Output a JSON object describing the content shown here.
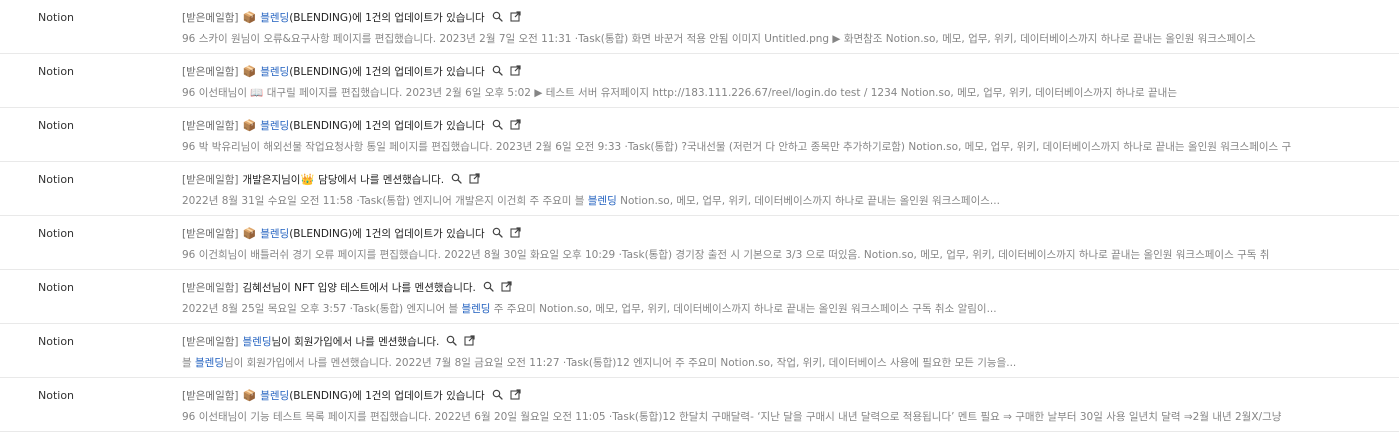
{
  "rows": [
    {
      "sender": "Notion",
      "tag": "[받은메일함]",
      "emoji": "📦",
      "subject_link": "블렌딩",
      "subject_rest": "(BLENDING)에 1건의 업데이트가 있습니다",
      "preview_prefix": "96 스카이 원님이 오류&요구사항 페이지를 편집했습니다. 2023년 2월 7일 오전 11:31 ·Task(통합) 화면 바꾼거 적용 안됨 이미지 Untitled.png ▶ 화면참조 Notion.so, 메모, 업무, 위키, 데이터베이스까지 하나로 끝내는 올인원 워크스페이스"
    },
    {
      "sender": "Notion",
      "tag": "[받은메일함]",
      "emoji": "📦",
      "subject_link": "블렌딩",
      "subject_rest": "(BLENDING)에 1건의 업데이트가 있습니다",
      "preview_prefix": "96 이선태님이 📖 대구릴 페이지를 편집했습니다. 2023년 2월 6일 오후 5:02 ▶ 테스트 서버 유저페이지 http://183.111.226.67/reel/login.do test / 1234 Notion.so, 메모, 업무, 위키, 데이터베이스까지 하나로 끝내는"
    },
    {
      "sender": "Notion",
      "tag": "[받은메일함]",
      "emoji": "📦",
      "subject_link": "블렌딩",
      "subject_rest": "(BLENDING)에 1건의 업데이트가 있습니다",
      "preview_prefix": "96 박 박유리님이 해외선물 작업요청사항 통일 페이지를 편집했습니다. 2023년 2월 6일 오전 9:33 ·Task(통합) ?국내선물 (저런거 다 안하고 종목만 추가하기로함) Notion.so, 메모, 업무, 위키, 데이터베이스까지 하나로 끝내는 올인원 워크스페이스 구"
    },
    {
      "sender": "Notion",
      "tag": "[받은메일함]",
      "emoji": "👑",
      "subject_pre": "개발은지님이 ",
      "subject_rest": " 담당에서 나를 멘션했습니다.",
      "preview_prefix": "2022년 8월 31일 수요일 오전 11:58 ·Task(통합) 엔지니어 개발은지 이건희 주 주요미 블 ",
      "preview_link": "블렌딩",
      "preview_suffix": " Notion.so, 메모, 업무, 위키, 데이터베이스까지 하나로 끝내는 올인원 워크스페이스..."
    },
    {
      "sender": "Notion",
      "tag": "[받은메일함]",
      "emoji": "📦",
      "subject_link": "블렌딩",
      "subject_rest": "(BLENDING)에 1건의 업데이트가 있습니다",
      "preview_prefix": "96 이건희님이 배틀러쉬 경기 오류 페이지를 편집했습니다. 2022년 8월 30일 화요일 오후 10:29 ·Task(통합) 경기장 출전 시 기본으로 3/3 으로 떠있음. Notion.so, 메모, 업무, 위키, 데이터베이스까지 하나로 끝내는 올인원 워크스페이스 구독 취"
    },
    {
      "sender": "Notion",
      "tag": "[받은메일함]",
      "subject_pre": "김혜선님이 NFT 입양 테스트에서 나를 멘션했습니다.",
      "preview_prefix": "2022년 8월 25일 목요일 오후 3:57 ·Task(통합) 엔지니어 블 ",
      "preview_link": "블렌딩",
      "preview_suffix": " 주 주요미 Notion.so, 메모, 업무, 위키, 데이터베이스까지 하나로 끝내는 올인원 워크스페이스 구독 취소 알림이..."
    },
    {
      "sender": "Notion",
      "tag": "[받은메일함]",
      "subject_link": "블렌딩",
      "subject_rest": "님이 회원가입에서 나를 멘션했습니다.",
      "preview_prefix": "블 ",
      "preview_link": "블렌딩",
      "preview_suffix": "님이 회원가입에서 나를 멘션했습니다. 2022년 7월 8일 금요일 오전 11:27 ·Task(통합)12 엔지니어 주 주요미 Notion.so, 작업, 위키, 데이터베이스 사용에 필요한 모든 기능을..."
    },
    {
      "sender": "Notion",
      "tag": "[받은메일함]",
      "emoji": "📦",
      "subject_link": "블렌딩",
      "subject_rest": "(BLENDING)에 1건의 업데이트가 있습니다",
      "preview_prefix": "96 이선태님이 기능 테스트 목록 페이지를 편집했습니다. 2022년 6월 20일 월요일 오전 11:05 ·Task(통합)12 한달치 구매달력- ‘지난 달을 구매시 내년 달력으로 적용됩니다’ 멘트 필요 ⇒ 구매한 날부터 30일 사용 일년치 달력 ⇒2월 내년 2월X/그냥"
    }
  ],
  "colors": {
    "link": "#1f5fbf",
    "preview_text": "#858585",
    "divider": "#e9e9e9"
  },
  "icons": [
    "search-icon",
    "open-external-icon"
  ]
}
